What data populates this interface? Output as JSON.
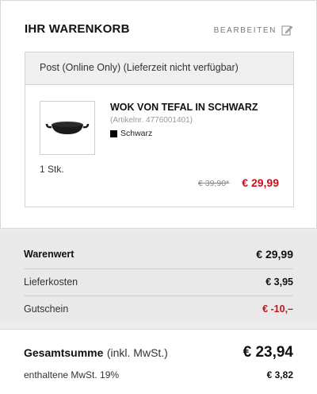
{
  "cart": {
    "title": "IHR WARENKORB",
    "edit_label": "BEARBEITEN",
    "edit_icon": "pencil-icon"
  },
  "shipping": {
    "method": "Post (Online Only) (Lieferzeit nicht verfügbar)"
  },
  "product": {
    "image_icon": "wok-icon",
    "name": "WOK VON TEFAL IN SCHWARZ",
    "article": "(Artikelnr. 4776001401)",
    "color_name": "Schwarz",
    "color_swatch": "#000000",
    "quantity": "1 Stk.",
    "old_price": "€ 39,90*",
    "price": "€ 29,99"
  },
  "summary": {
    "goods_label": "Warenwert",
    "goods_value": "€ 29,99",
    "delivery_label": "Lieferkosten",
    "delivery_value": "€ 3,95",
    "voucher_label": "Gutschein",
    "voucher_value": "€ -10,–"
  },
  "total": {
    "label": "Gesamtsumme",
    "note": "(inkl. MwSt.)",
    "value": "€ 23,94",
    "vat_label": "enthaltene MwSt. 19%",
    "vat_value": "€ 3,82"
  },
  "colors": {
    "accent_red": "#c4121f",
    "background": "#ececec"
  }
}
